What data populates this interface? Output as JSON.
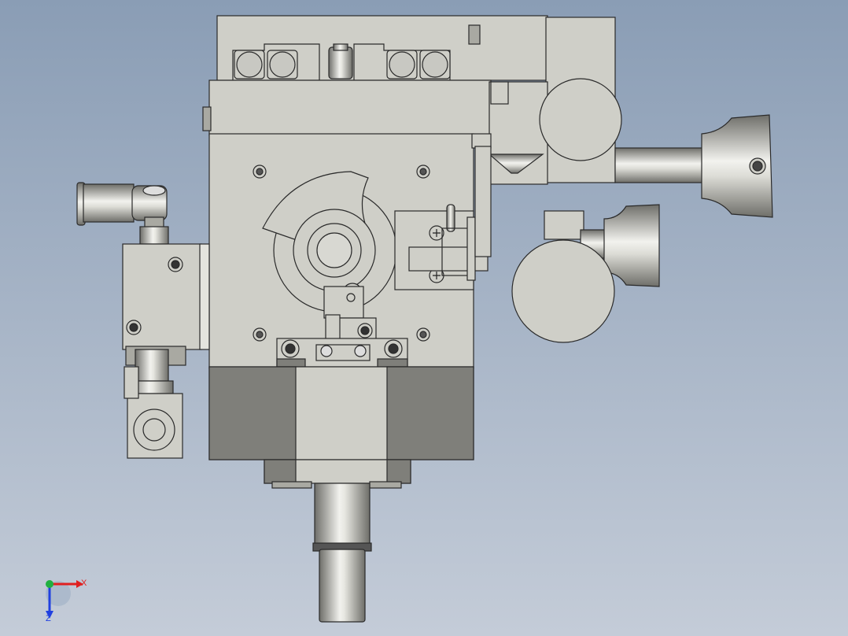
{
  "viewport": {
    "background_top": "#8a9db5",
    "background_bottom": "#c4ccd8",
    "part_fill": "#cfcfc8",
    "part_shade": "#7f7f7a",
    "part_mid": "#a9a9a2",
    "edge_color": "#2a2a2a",
    "metal_light": "#f2f2ee",
    "metal_dark": "#6e6e69"
  },
  "triad": {
    "x_label": "X",
    "z_label": "Z",
    "x_color": "#e02020",
    "y_color": "#20b040",
    "z_color": "#2040e0"
  }
}
